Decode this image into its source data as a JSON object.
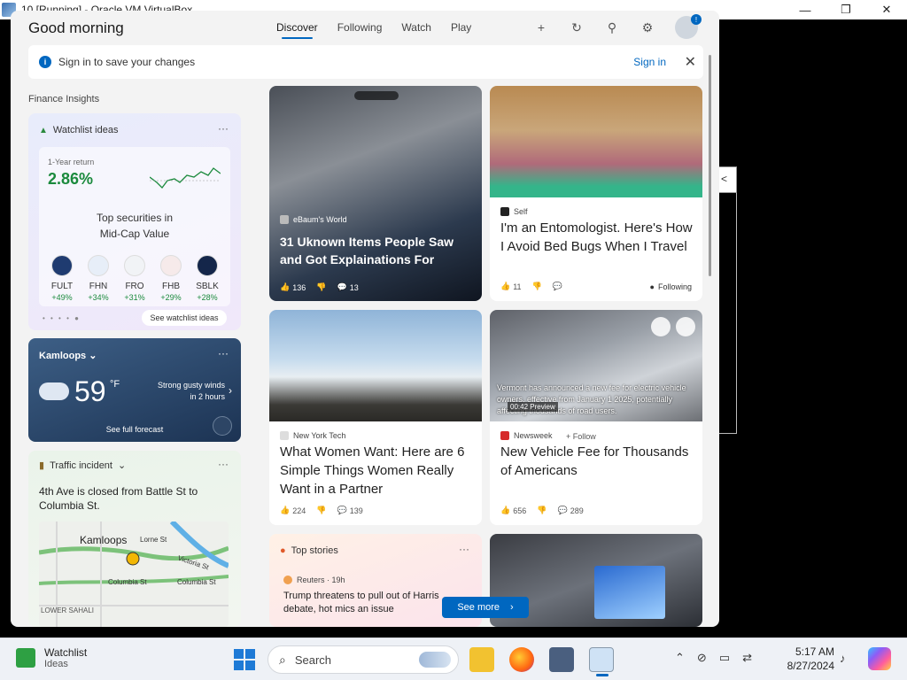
{
  "host_window": {
    "title": "10 [Running] - Oracle VM VirtualBox",
    "minimize": "—",
    "maximize": "❐",
    "close": "✕"
  },
  "side_fragment": "<",
  "widgets": {
    "greeting": "Good morning",
    "tabs": [
      {
        "label": "Discover",
        "active": true
      },
      {
        "label": "Following",
        "active": false
      },
      {
        "label": "Watch",
        "active": false
      },
      {
        "label": "Play",
        "active": false
      }
    ],
    "header_icons": [
      "plus-icon",
      "refresh-icon",
      "pin-icon",
      "gear-icon",
      "avatar"
    ],
    "header_glyphs": {
      "plus": "+",
      "refresh": "↻",
      "pin": "⚲",
      "gear": "⚙"
    },
    "avatar_badge": "!",
    "signin": {
      "info_glyph": "i",
      "message": "Sign in to save your changes",
      "link": "Sign in",
      "close": "✕"
    },
    "section_label": "Finance Insights",
    "watchlist": {
      "title": "Watchlist ideas",
      "menu": "···",
      "return_label": "1-Year return",
      "return_value": "2.86%",
      "category_line1": "Top securities in",
      "category_line2": "Mid-Cap Value",
      "tickers": [
        {
          "symbol": "FULT",
          "change": "+49%",
          "color": "#1f3b70"
        },
        {
          "symbol": "FHN",
          "change": "+34%",
          "color": "#e7eef8"
        },
        {
          "symbol": "FRO",
          "change": "+31%",
          "color": "#f1f3f6"
        },
        {
          "symbol": "FHB",
          "change": "+29%",
          "color": "#f6eaea"
        },
        {
          "symbol": "SBLK",
          "change": "+28%",
          "color": "#14264a"
        }
      ],
      "pager": "• • • • ●",
      "see_button": "See watchlist ideas",
      "accent": "#1b8a3d"
    },
    "weather": {
      "city": "Kamloops",
      "chevron": "⌄",
      "menu": "···",
      "temperature": "59",
      "unit": "°F",
      "condition_line1": "Strong gusty winds",
      "condition_line2": "in 2 hours",
      "arrow": "›",
      "forecast_link": "See full forecast"
    },
    "traffic": {
      "title": "Traffic incident",
      "chevron": "⌄",
      "menu": "···",
      "description": "4th Ave is closed from Battle St to Columbia St.",
      "map_labels": {
        "city": "Kamloops",
        "lorne": "Lorne St",
        "victoria": "Victoria St",
        "columbia1": "Columbia St",
        "columbia2": "Columbia St",
        "sahali": "LOWER SAHALI"
      }
    },
    "feed": [
      {
        "source": "eBaum's World",
        "headline": "31 Uknown Items People Saw and Got Explainations For",
        "likes": "136",
        "comments": "13"
      },
      {
        "source": "Self",
        "headline": "I'm an Entomologist. Here's How I Avoid Bed Bugs When I Travel",
        "likes": "11",
        "follow_status": "Following"
      },
      {
        "source": "New York Tech",
        "headline": "What Women Want: Here are 6 Simple Things Women Really Want in a Partner",
        "likes": "224",
        "comments": "139"
      },
      {
        "source": "Newsweek",
        "follow": "+ Follow",
        "headline": "New Vehicle Fee for Thousands of Americans",
        "likes": "656",
        "comments": "289",
        "video_caption": "Vermont has announced a new fee for electric vehicle owners, effective from January 1 2025, potentially affecting thousands of road users.",
        "video_time": "00:42",
        "video_badge": "Preview"
      }
    ],
    "top_stories": {
      "title": "Top stories",
      "menu": "···",
      "source": "Reuters · 19h",
      "story": "Trump threatens to pull out of Harris debate, hot mics an issue"
    },
    "see_more": "See more",
    "see_more_chevron": "›"
  },
  "taskbar": {
    "widget_title": "Watchlist",
    "widget_subtitle": "Ideas",
    "search_icon": "⌕",
    "search_label": "Search",
    "tray_icons": [
      "chevron-up-icon",
      "network-icon",
      "display-icon",
      "sync-icon"
    ],
    "tray_glyphs": {
      "chevron": "⌃",
      "network": "⊘",
      "display": "▭",
      "sync": "⇄"
    },
    "time": "5:17 AM",
    "date": "8/27/2024",
    "bell": "♪"
  }
}
